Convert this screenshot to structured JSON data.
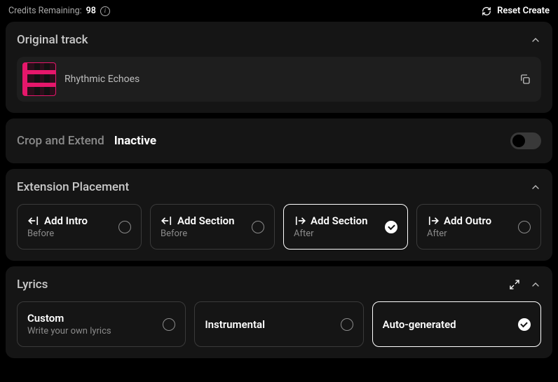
{
  "topbar": {
    "credits_label": "Credits Remaining:",
    "credits_value": "98",
    "reset_label": "Reset Create"
  },
  "original_track": {
    "title": "Original track",
    "track_name": "Rhythmic Echoes"
  },
  "crop_extend": {
    "label": "Crop and Extend",
    "state": "Inactive",
    "enabled": false
  },
  "extension": {
    "title": "Extension Placement",
    "options": [
      {
        "main": "Add Intro",
        "sub": "Before",
        "dir": "left",
        "selected": false
      },
      {
        "main": "Add Section",
        "sub": "Before",
        "dir": "left",
        "selected": false
      },
      {
        "main": "Add Section",
        "sub": "After",
        "dir": "right",
        "selected": true
      },
      {
        "main": "Add Outro",
        "sub": "After",
        "dir": "right",
        "selected": false
      }
    ]
  },
  "lyrics": {
    "title": "Lyrics",
    "options": [
      {
        "main": "Custom",
        "sub": "Write your own lyrics",
        "selected": false
      },
      {
        "main": "Instrumental",
        "sub": "",
        "selected": false
      },
      {
        "main": "Auto-generated",
        "sub": "",
        "selected": true
      }
    ]
  }
}
